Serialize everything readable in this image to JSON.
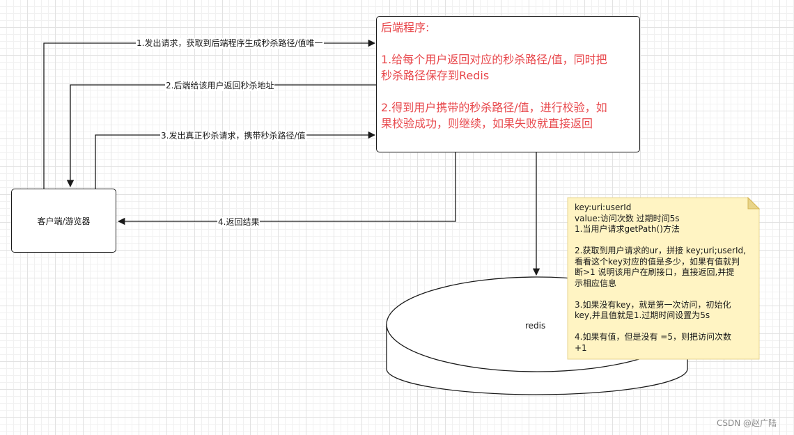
{
  "client": {
    "label": "客户端/游览器"
  },
  "backend": {
    "title": "后端程序:",
    "line1a": "1.给每个用户返回对应的秒杀路径/值，同时把",
    "line1b": "秒杀路径保存到Redis",
    "line2a": "2.得到用户携带的秒杀路径/值，进行校验，如",
    "line2b": "果校验成功，则继续，如果失败就直接返回"
  },
  "edges": {
    "e1": "1.发出请求，获取到后端程序生成秒杀路径/值唯一",
    "e2": "2.后端给该用户返回秒杀地址",
    "e3": "3.发出真正秒杀请求，携带秒杀路径/值",
    "e4": "4.返回结果"
  },
  "redis": {
    "label": "redis"
  },
  "note": {
    "l1": "key:uri:userId",
    "l2": "value:访问次数 过期时间5s",
    "l3": "1.当用户请求getPath()方法",
    "l4": "2.获取到用户请求的ur，拼接 key;uri;userId,",
    "l5": "看看这个key对应的值是多少，如果有值就判",
    "l6": "断>1 说明该用户在刷接口，直接返回,并提",
    "l7": "示相应信息",
    "l8": "3.如果没有key，就是第一次访问，初始化",
    "l9": "key,并且值就是1.过期时间设置为5s",
    "l10": "4.如果有值，但是没有 =5，则把访问次数",
    "l11": "+1"
  },
  "watermark": "CSDN @赵广陆",
  "colors": {
    "backend_text": "#e8484c",
    "note_fill": "#fff4c3",
    "note_stroke": "#d6b656"
  }
}
